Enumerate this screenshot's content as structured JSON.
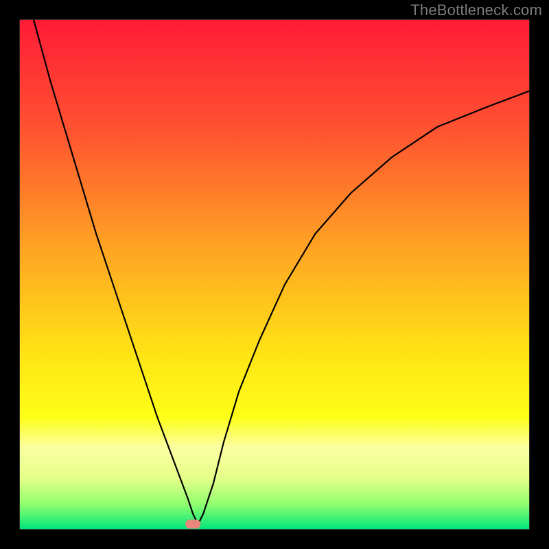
{
  "attribution": "TheBottleneck.com",
  "chart_data": {
    "type": "line",
    "title": "",
    "xlabel": "",
    "ylabel": "",
    "xlim": [
      0,
      100
    ],
    "ylim": [
      0,
      100
    ],
    "grid": false,
    "legend": false,
    "series": [
      {
        "name": "bottleneck-curve",
        "x": [
          0,
          3,
          6,
          9,
          12,
          15,
          18,
          21,
          24,
          27,
          30,
          33,
          34,
          35,
          36,
          38,
          40,
          43,
          47,
          52,
          58,
          65,
          73,
          82,
          92,
          100
        ],
        "y": [
          110,
          99,
          88,
          78,
          68,
          58,
          49,
          40,
          31,
          22,
          14,
          6,
          3,
          1,
          3,
          9,
          17,
          27,
          37,
          48,
          58,
          66,
          73,
          79,
          83,
          86
        ]
      }
    ],
    "background_gradient": {
      "stops": [
        {
          "y_pct": 0,
          "color": "#ff1b37"
        },
        {
          "y_pct": 22,
          "color": "#ff5430"
        },
        {
          "y_pct": 45,
          "color": "#ffa423"
        },
        {
          "y_pct": 65,
          "color": "#ffe215"
        },
        {
          "y_pct": 78,
          "color": "#feff17"
        },
        {
          "y_pct": 84,
          "color": "#fbffa3"
        },
        {
          "y_pct": 90,
          "color": "#e4ff88"
        },
        {
          "y_pct": 95,
          "color": "#93ff6f"
        },
        {
          "y_pct": 100,
          "color": "#00e67a"
        }
      ]
    },
    "marker": {
      "x": 34,
      "y_pct": 99,
      "color": "#e6887b"
    },
    "frame": {
      "thickness_pct": 3.6,
      "color": "#000000"
    }
  }
}
